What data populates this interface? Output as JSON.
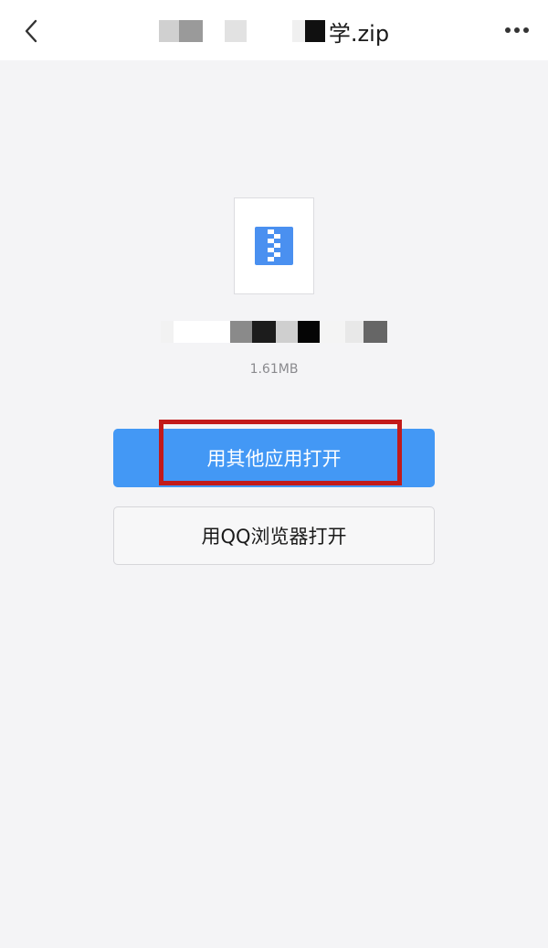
{
  "header": {
    "title_visible_suffix": "学.zip",
    "back_icon": "chevron-left-icon",
    "more_icon": "more-horizontal-icon"
  },
  "file": {
    "icon": "zip-file-icon",
    "size": "1.61MB"
  },
  "actions": {
    "open_other_app_label": "用其他应用打开",
    "open_qq_browser_label": "用QQ浏览器打开"
  },
  "colors": {
    "primary_button": "#4398f5",
    "highlight_border": "#c21a1a",
    "background": "#f4f4f6",
    "zip_icon": "#4a90f0"
  }
}
